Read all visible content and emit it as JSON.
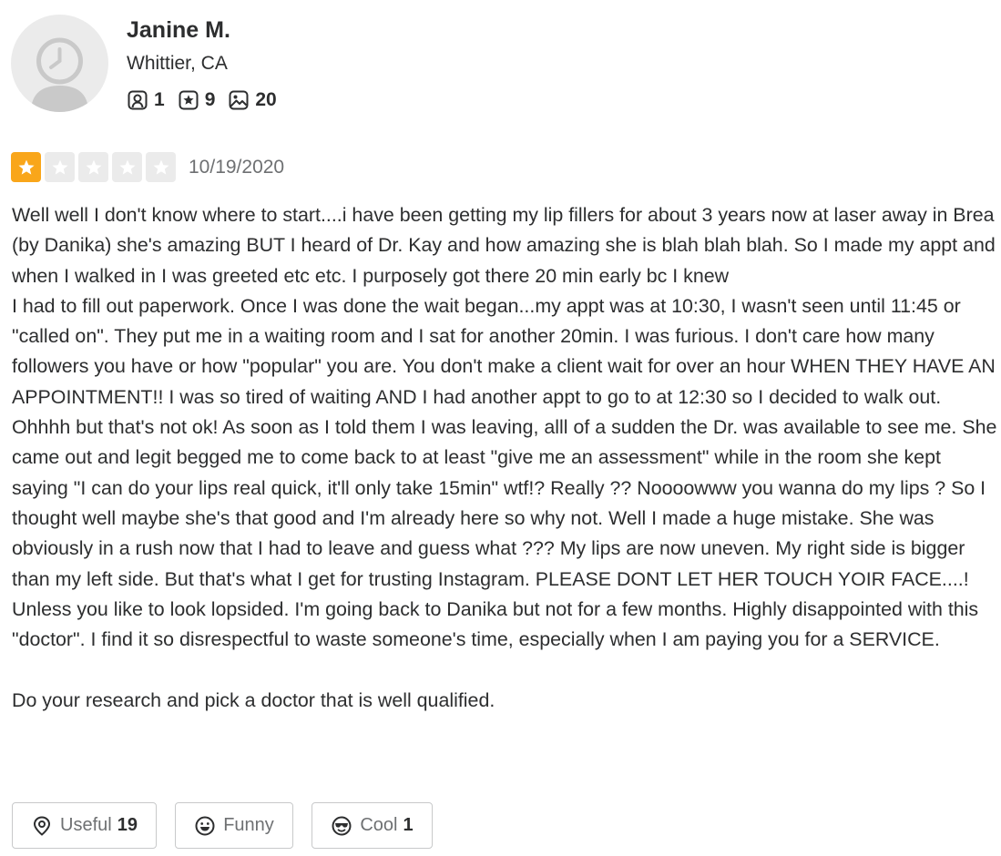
{
  "user": {
    "name": "Janine M.",
    "location": "Whittier, CA",
    "stats": {
      "friends": "1",
      "reviews": "9",
      "photos": "20"
    }
  },
  "review": {
    "rating": 1,
    "max_rating": 5,
    "star_color_filled": "#f9a61a",
    "star_color_empty": "#ebebeb",
    "date": "10/19/2020",
    "text": "Well well I don't know where to start....i have been getting my lip fillers for about 3 years now at laser away in Brea (by Danika) she's amazing BUT I heard of Dr. Kay and how amazing she is blah blah blah. So I made my appt and when I walked in I was greeted etc etc. I purposely got there 20 min early bc I knew\nI had to fill out paperwork. Once I was done the wait began...my appt was at 10:30, I wasn't seen until 11:45 or \"called on\". They put me in a waiting room and I sat for another 20min. I was furious. I don't care how many followers you have or how \"popular\" you are. You don't make a client wait for over an hour WHEN THEY HAVE AN APPOINTMENT!! I was so tired of waiting AND I had another appt to go to at 12:30 so I decided to walk out. Ohhhh but that's not ok! As soon as I told them I was leaving, alll of a sudden the Dr. was available to see me. She came out and legit begged me to come back to at least \"give me an assessment\" while in the room she kept saying \"I can do your lips real quick, it'll only take 15min\" wtf!? Really ?? Noooowww you wanna do my lips ? So I thought well maybe she's that good and I'm already here so why not. Well I made a huge mistake. She was obviously in a rush now that I had to leave and guess what ??? My lips are now uneven. My right side is bigger than my left side. But that's what I get for trusting Instagram. PLEASE DONT LET HER TOUCH YOIR FACE....! Unless you like to look lopsided. I'm going back to Danika but not for a few months. Highly disappointed with this \"doctor\". I find it so disrespectful to waste someone's time, especially when I am paying you for a SERVICE.\n\nDo your research and pick a doctor that is well qualified."
  },
  "reactions": {
    "useful": {
      "label": "Useful",
      "count": "19",
      "icon": "lightbulb-icon"
    },
    "funny": {
      "label": "Funny",
      "count": "",
      "icon": "smile-icon"
    },
    "cool": {
      "label": "Cool",
      "count": "1",
      "icon": "sunglasses-icon"
    }
  },
  "icons": {
    "friends": "friends-icon",
    "reviews": "review-star-icon",
    "photos": "photo-icon"
  }
}
